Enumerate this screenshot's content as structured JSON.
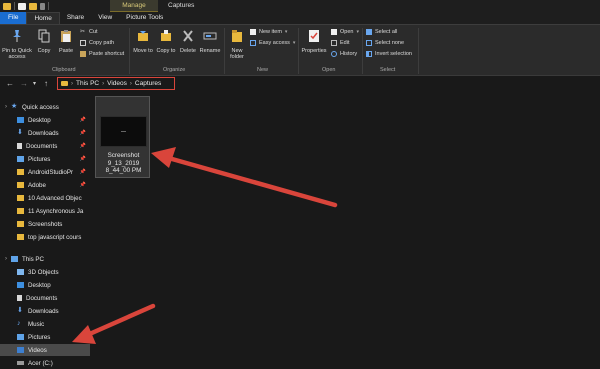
{
  "window": {
    "title": "Captures",
    "contextual_tab": "Manage"
  },
  "tabs": [
    "File",
    "Home",
    "Share",
    "View",
    "Picture Tools"
  ],
  "ribbon": {
    "clipboard": {
      "label": "Clipboard",
      "pin_quick_access": "Pin to Quick access",
      "copy": "Copy",
      "paste": "Paste",
      "cut": "Cut",
      "copy_path": "Copy path",
      "paste_shortcut": "Paste shortcut"
    },
    "organize": {
      "label": "Organize",
      "move_to": "Move to",
      "copy_to": "Copy to",
      "delete": "Delete",
      "rename": "Rename"
    },
    "new": {
      "label": "New",
      "new_folder": "New folder",
      "new_item": "New item",
      "easy_access": "Easy access"
    },
    "open": {
      "label": "Open",
      "properties": "Properties",
      "open": "Open",
      "edit": "Edit",
      "history": "History"
    },
    "select": {
      "label": "Select",
      "select_all": "Select all",
      "select_none": "Select none",
      "invert_selection": "Invert selection"
    }
  },
  "address": {
    "crumbs": [
      "This PC",
      "Videos",
      "Captures"
    ]
  },
  "sidebar": {
    "quick_access": "Quick access",
    "quick_items": [
      "Desktop",
      "Downloads",
      "Documents",
      "Pictures",
      "AndroidStudioPr",
      "Adobe",
      "10 Advanced Objec",
      "11 Asynchronous Ja",
      "Screenshots",
      "top javascript cours"
    ],
    "this_pc": "This PC",
    "pc_items": [
      "3D Objects",
      "Desktop",
      "Documents",
      "Downloads",
      "Music",
      "Pictures",
      "Videos",
      "Acer (C:)"
    ]
  },
  "files": [
    {
      "name_lines": [
        "Screenshot",
        "9_13_2019",
        "8_44_00 PM"
      ]
    }
  ],
  "colors": {
    "accent_blue": "#1a6dd1",
    "annotation_red": "#d9453b",
    "folder_yellow": "#e8b83d",
    "background": "#191919"
  }
}
